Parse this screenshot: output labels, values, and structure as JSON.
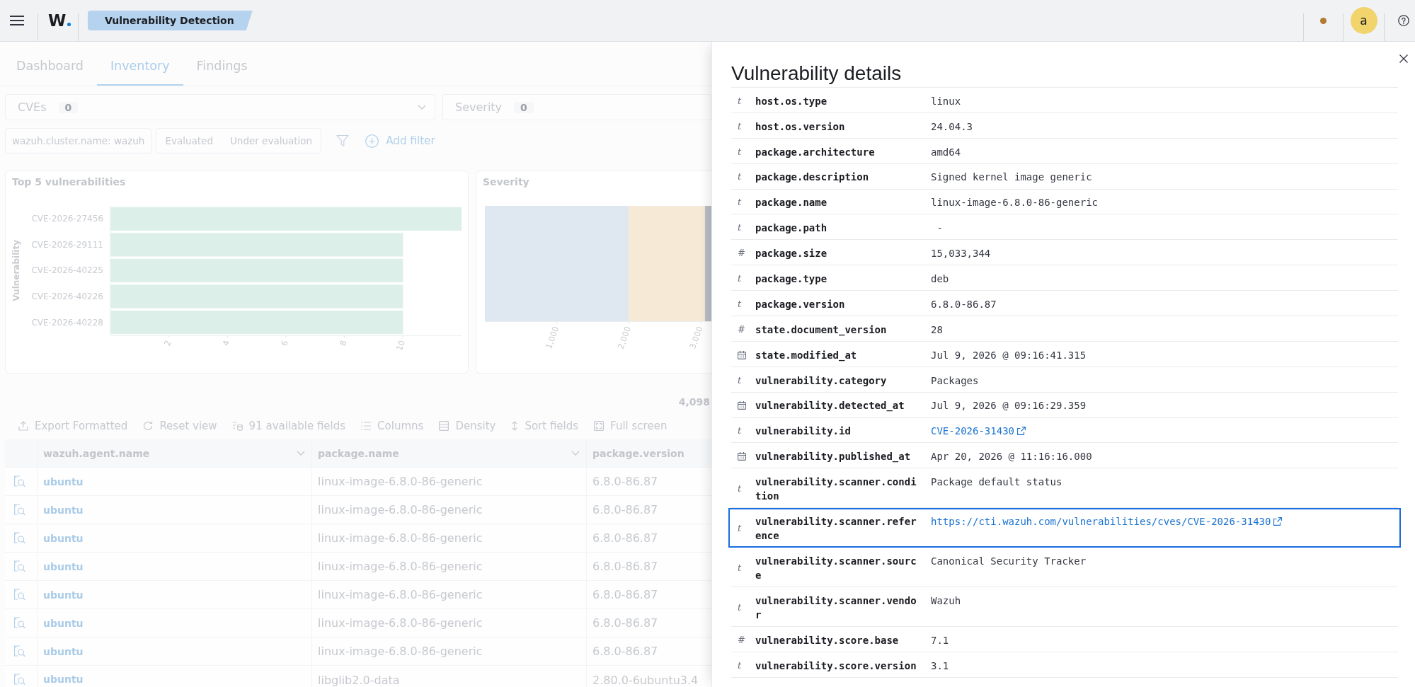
{
  "header": {
    "logo": "W",
    "breadcrumb": "Vulnerability Detection",
    "avatar": "a"
  },
  "tabs": [
    {
      "label": "Dashboard",
      "selected": false
    },
    {
      "label": "Inventory",
      "selected": true
    },
    {
      "label": "Findings",
      "selected": false
    }
  ],
  "selectors": [
    {
      "label": "CVEs",
      "count": "0",
      "dropdown_arrow": true
    },
    {
      "label": "Severity",
      "count": "0",
      "dropdown_arrow": false
    }
  ],
  "filter_bar": {
    "pills": [
      "wazuh.cluster.name: wazuh"
    ],
    "status_options": [
      "Evaluated",
      "Under evaluation"
    ],
    "add_filter": "Add filter"
  },
  "charts": [
    {
      "title": "Top 5 vulnerabilities",
      "chart_data": {
        "type": "bar",
        "orientation": "horizontal",
        "ylabel": "Vulnerability",
        "categories": [
          "CVE-2026-27456",
          "CVE-2026-29111",
          "CVE-2026-40225",
          "CVE-2026-40226",
          "CVE-2026-40228"
        ],
        "series": [
          {
            "color": "#dcefe8",
            "values": [
              12,
              10,
              10,
              10,
              10
            ]
          }
        ],
        "xlim": [
          0,
          12
        ],
        "xticks": [
          2,
          4,
          6,
          8,
          10
        ]
      }
    },
    {
      "title": "Severity",
      "chart_data": {
        "type": "bar",
        "orientation": "horizontal",
        "stacked": true,
        "series": [
          {
            "color": "#dfe7f0",
            "values": [
              2000
            ]
          },
          {
            "color": "#f6e9d6",
            "values": [
              1060
            ]
          },
          {
            "color": "#b9bdc4",
            "values": [
              90
            ]
          }
        ],
        "xlim": [
          0,
          3150
        ],
        "xticks": [
          {
            "value": 1000,
            "label": "1,000"
          },
          {
            "value": 2000,
            "label": "2,000"
          },
          {
            "value": 3000,
            "label": "3,000"
          }
        ]
      }
    }
  ],
  "results": {
    "hits": "4,098",
    "toolbar": [
      {
        "kind": "export",
        "label": "Export Formatted"
      },
      {
        "kind": "reset",
        "label": "Reset view"
      },
      {
        "kind": "fields",
        "label": "91 available fields"
      },
      {
        "kind": "columns",
        "label": "Columns"
      },
      {
        "kind": "density",
        "label": "Density"
      },
      {
        "kind": "sort",
        "label": "Sort fields"
      },
      {
        "kind": "fullscreen",
        "label": "Full screen"
      }
    ],
    "table": {
      "columns": [
        {
          "label": "wazuh.agent.name",
          "kind": "link",
          "menu": true
        },
        {
          "label": "package.name",
          "kind": "text",
          "menu": true
        },
        {
          "label": "package.version",
          "kind": "text",
          "menu": false
        }
      ],
      "rows": [
        [
          "ubuntu",
          "linux-image-6.8.0-86-generic",
          "6.8.0-86.87"
        ],
        [
          "ubuntu",
          "linux-image-6.8.0-86-generic",
          "6.8.0-86.87"
        ],
        [
          "ubuntu",
          "linux-image-6.8.0-86-generic",
          "6.8.0-86.87"
        ],
        [
          "ubuntu",
          "linux-image-6.8.0-86-generic",
          "6.8.0-86.87"
        ],
        [
          "ubuntu",
          "linux-image-6.8.0-86-generic",
          "6.8.0-86.87"
        ],
        [
          "ubuntu",
          "linux-image-6.8.0-86-generic",
          "6.8.0-86.87"
        ],
        [
          "ubuntu",
          "linux-image-6.8.0-86-generic",
          "6.8.0-86.87"
        ],
        [
          "ubuntu",
          "libglib2.0-data",
          "2.80.0-6ubuntu3.4"
        ]
      ]
    }
  },
  "details": {
    "title": "Vulnerability details",
    "fields": [
      {
        "kind": "string",
        "token": "t",
        "name": "host.os.type",
        "value": "linux",
        "link": false,
        "selected": false
      },
      {
        "kind": "string",
        "token": "t",
        "name": "host.os.version",
        "value": "24.04.3",
        "link": false,
        "selected": false
      },
      {
        "kind": "string",
        "token": "t",
        "name": "package.architecture",
        "value": "amd64",
        "link": false,
        "selected": false
      },
      {
        "kind": "string",
        "token": "t",
        "name": "package.description",
        "value": "Signed kernel image generic",
        "link": false,
        "selected": false
      },
      {
        "kind": "string",
        "token": "t",
        "name": "package.name",
        "value": "linux-image-6.8.0-86-generic",
        "link": false,
        "selected": false
      },
      {
        "kind": "string",
        "token": "t",
        "name": "package.path",
        "value": " -",
        "link": false,
        "selected": false
      },
      {
        "kind": "number",
        "token": "#",
        "name": "package.size",
        "value": "15,033,344",
        "link": false,
        "selected": false
      },
      {
        "kind": "string",
        "token": "t",
        "name": "package.type",
        "value": "deb",
        "link": false,
        "selected": false
      },
      {
        "kind": "string",
        "token": "t",
        "name": "package.version",
        "value": "6.8.0-86.87",
        "link": false,
        "selected": false
      },
      {
        "kind": "number",
        "token": "#",
        "name": "state.document_version",
        "value": "28",
        "link": false,
        "selected": false
      },
      {
        "kind": "date",
        "name": "state.modified_at",
        "value": "Jul 9, 2026 @ 09:16:41.315",
        "link": false,
        "selected": false
      },
      {
        "kind": "string",
        "token": "t",
        "name": "vulnerability.category",
        "value": "Packages",
        "link": false,
        "selected": false
      },
      {
        "kind": "date",
        "name": "vulnerability.detected_at",
        "value": "Jul 9, 2026 @ 09:16:29.359",
        "link": false,
        "selected": false
      },
      {
        "kind": "string",
        "token": "t",
        "name": "vulnerability.id",
        "value": "CVE-2026-31430",
        "link": true,
        "selected": false
      },
      {
        "kind": "date",
        "name": "vulnerability.published_at",
        "value": "Apr 20, 2026 @ 11:16:16.000",
        "link": false,
        "selected": false
      },
      {
        "kind": "string",
        "token": "t",
        "name": "vulnerability.scanner.condition",
        "value": "Package default status",
        "link": false,
        "selected": false
      },
      {
        "kind": "string",
        "token": "t",
        "name": "vulnerability.scanner.reference",
        "value": "https://cti.wazuh.com/vulnerabilities/cves/CVE-2026-31430",
        "link": true,
        "selected": true
      },
      {
        "kind": "string",
        "token": "t",
        "name": "vulnerability.scanner.source",
        "value": "Canonical Security Tracker",
        "link": false,
        "selected": false
      },
      {
        "kind": "string",
        "token": "t",
        "name": "vulnerability.scanner.vendor",
        "value": "Wazuh",
        "link": false,
        "selected": false
      },
      {
        "kind": "number",
        "token": "#",
        "name": "vulnerability.score.base",
        "value": "7.1",
        "link": false,
        "selected": false
      },
      {
        "kind": "string",
        "token": "t",
        "name": "vulnerability.score.version",
        "value": "3.1",
        "link": false,
        "selected": false
      }
    ]
  }
}
